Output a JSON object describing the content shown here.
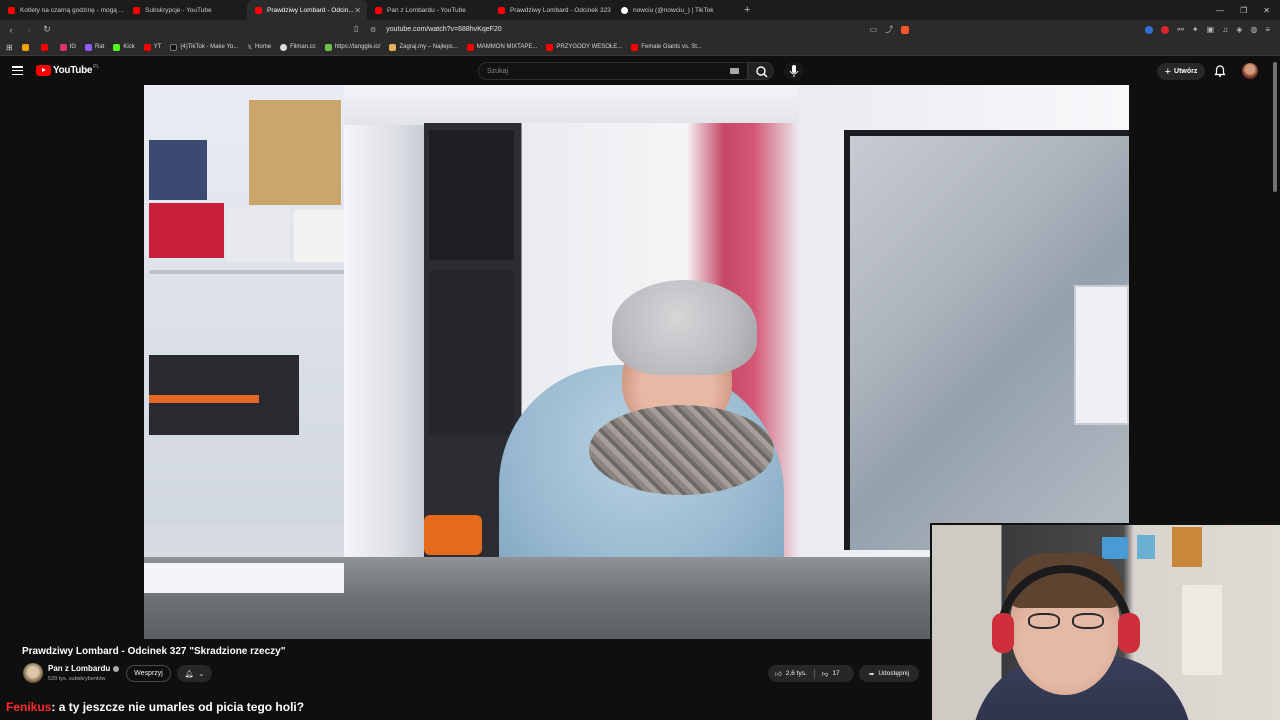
{
  "browser": {
    "tabs": [
      {
        "label": "Kotlety na czarną godzinę - mogą ..."
      },
      {
        "label": "Subskrypcje - YouTube"
      },
      {
        "label": "Prawdziwy Lombard - Odcin..."
      },
      {
        "label": "Pan z Lombardu - YouTube"
      },
      {
        "label": "Prawdziwy Lombard - Odcinek 323"
      },
      {
        "label": "nowciu (@nowciu_) | TikTok"
      }
    ],
    "url": "youtube.com/watch?v=688hvKqeF20",
    "bookmarks": [
      {
        "label": "IG"
      },
      {
        "label": "Rat"
      },
      {
        "label": "Kick"
      },
      {
        "label": "YT"
      },
      {
        "label": "(4)TikTok - Make Yo..."
      },
      {
        "label": "Home"
      },
      {
        "label": "Filman.cc"
      },
      {
        "label": "https://tanggle.io/"
      },
      {
        "label": "Zagraj.my – Najleps..."
      },
      {
        "label": "MAMMON MIXTAPE..."
      },
      {
        "label": "PRZYGODY WESOŁE..."
      },
      {
        "label": "Female Giants vs. St..."
      }
    ],
    "colors": {
      "accent": "#ff0000",
      "tab_bg": "#1c1c1c",
      "active_tab_bg": "#2b2b2b"
    }
  },
  "youtube": {
    "logo_text": "YouTube",
    "logo_region": "PL",
    "search_placeholder": "Szukaj",
    "create_label": "Utwórz"
  },
  "video": {
    "title": "Prawdziwy Lombard - Odcinek 327 \"Skradzione rzeczy\"",
    "channel_name": "Pan z Lombardu",
    "subscribers": "539 tys. subskrybentów",
    "support_label": "Wesprzyj",
    "likes": "2,6 tys.",
    "dislikes": "17",
    "share_label": "Udostępnij"
  },
  "chat": {
    "user": "Fenikus",
    "message": ": a ty jeszcze nie umarles od picia tego holi?"
  }
}
